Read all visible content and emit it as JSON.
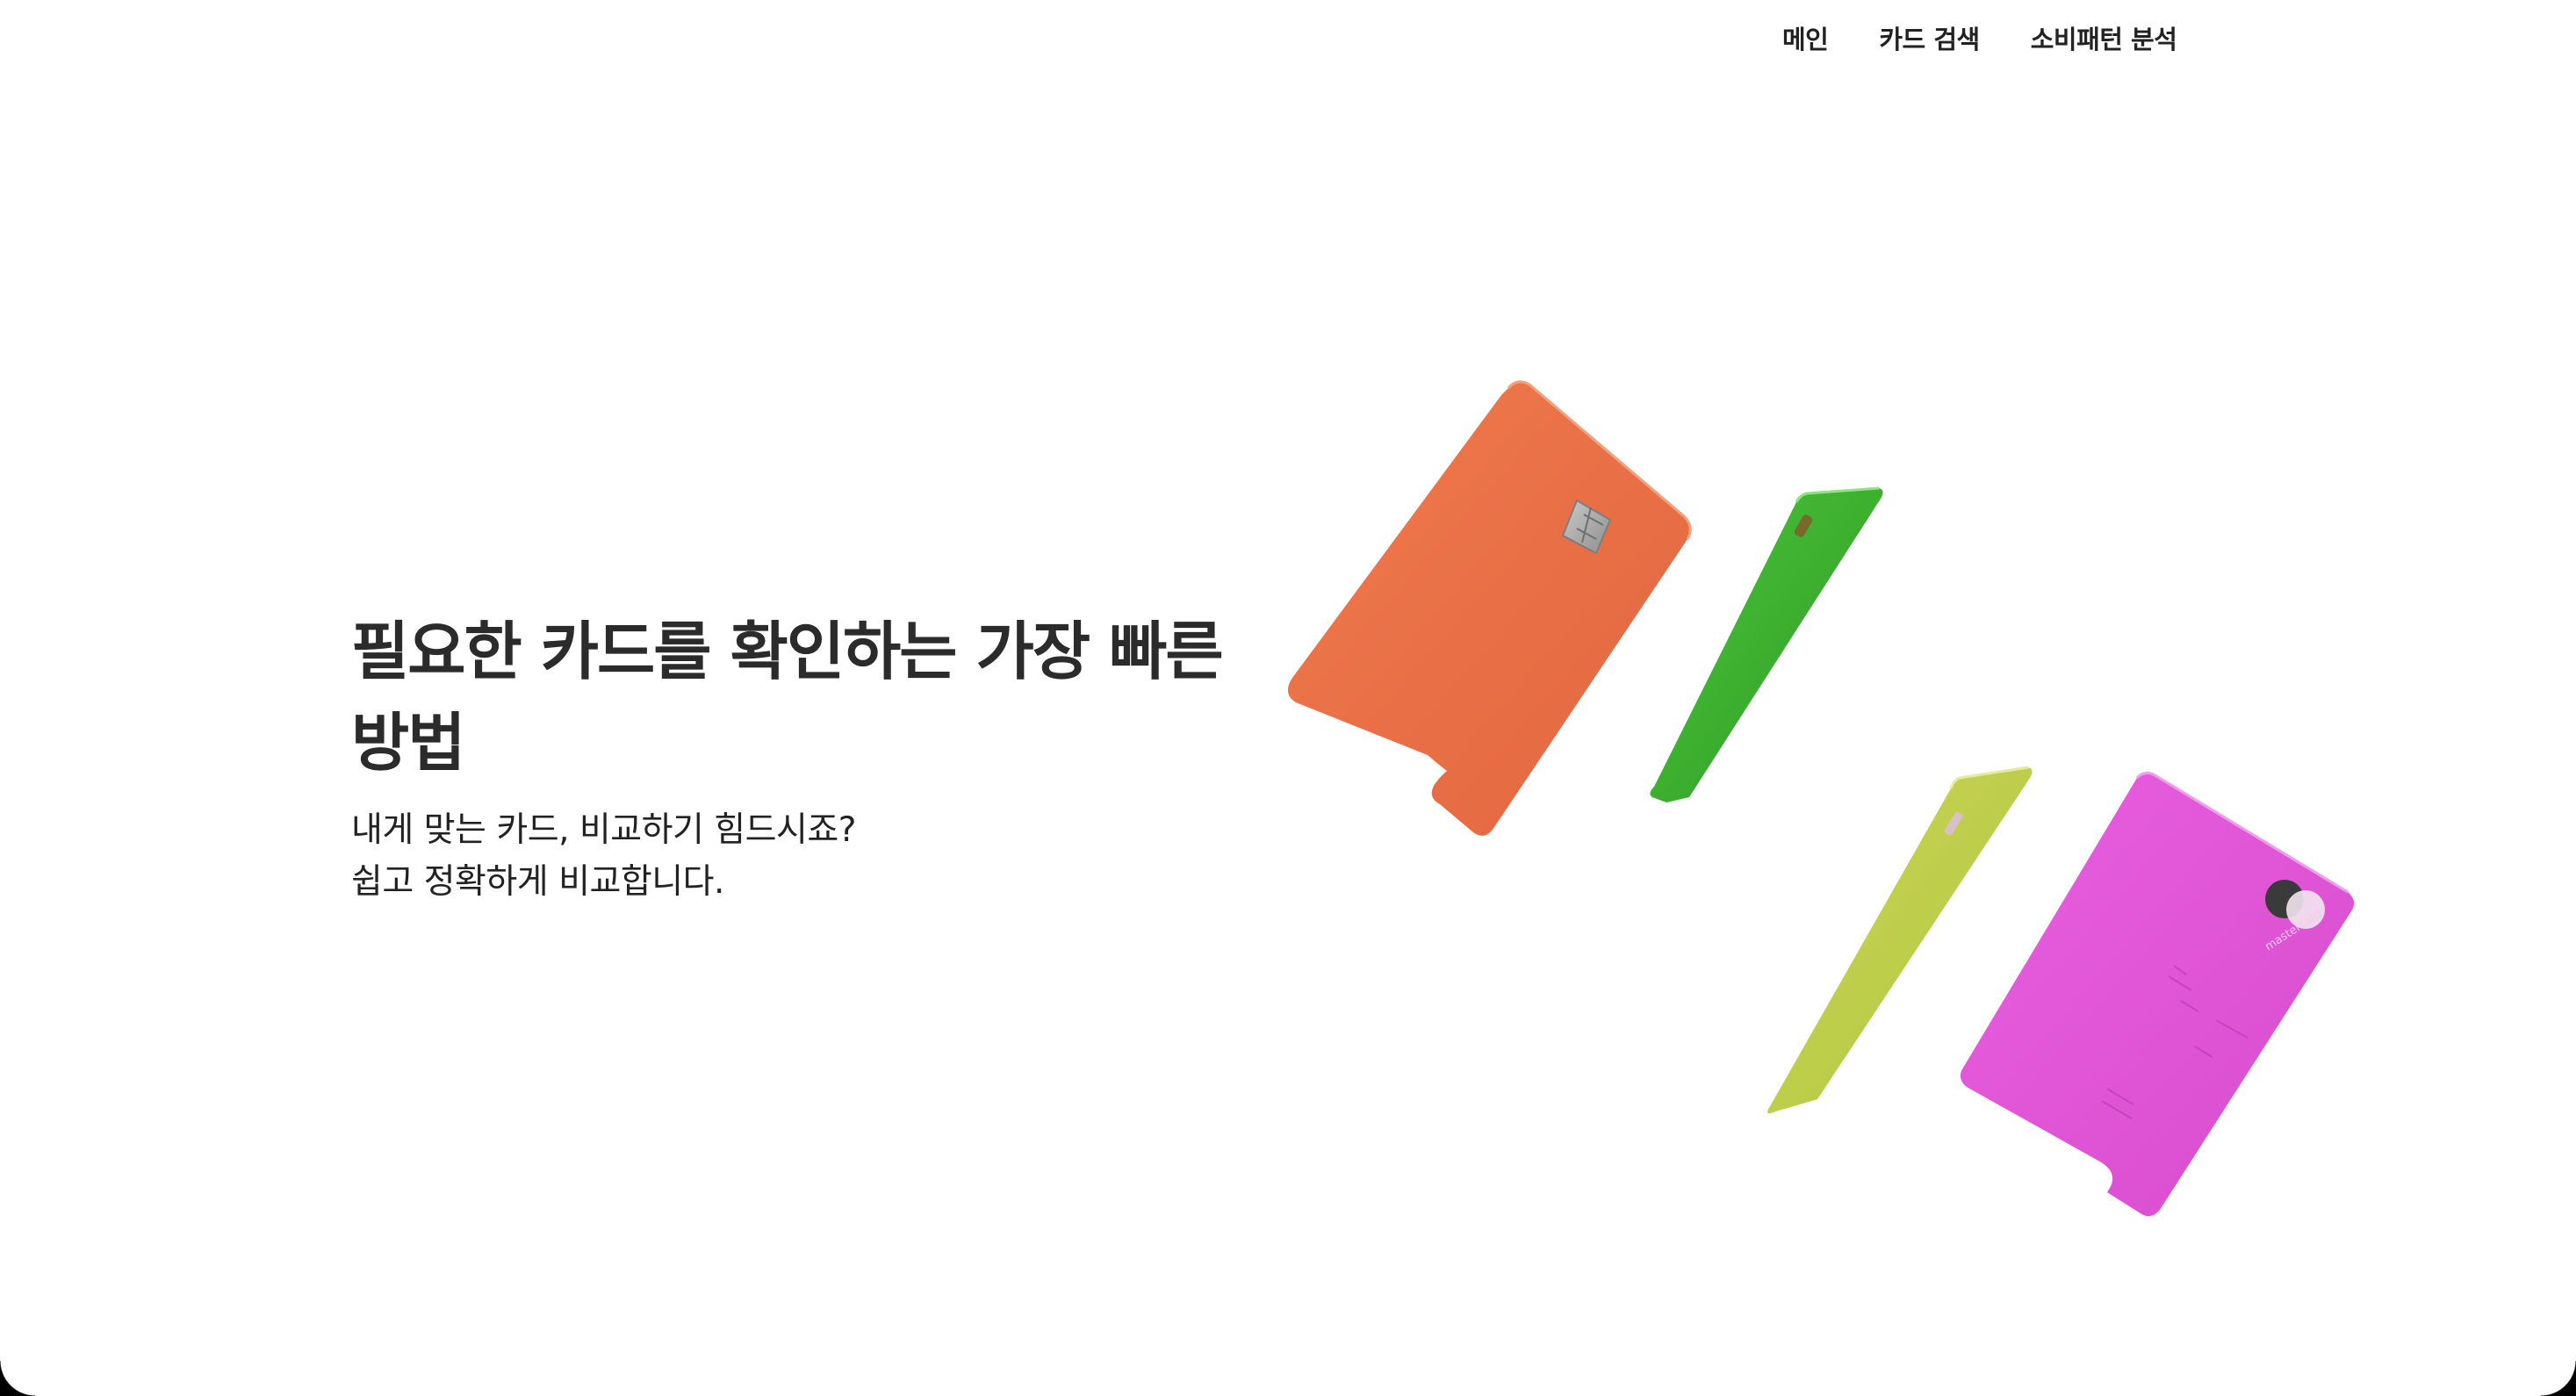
{
  "nav": {
    "items": [
      {
        "label": "메인"
      },
      {
        "label": "카드 검색"
      },
      {
        "label": "소비패턴 분석"
      }
    ]
  },
  "hero": {
    "title": "필요한 카드를 확인하는 가장 빠른 방법",
    "subtitle_line1": "내게 맞는 카드, 비교하기 힘드시죠?",
    "subtitle_line2": "쉽고 정확하게 비교합니다."
  },
  "cards": {
    "orange": "#e9704a",
    "green": "#3ab02e",
    "lime": "#b8cf4a",
    "magenta": "#df56d6",
    "magenta_card_print": "mastercard"
  }
}
